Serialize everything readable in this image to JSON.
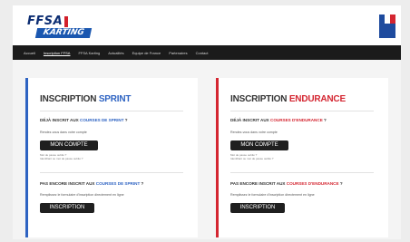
{
  "header": {
    "logo_top": "FFSA",
    "logo_bottom": "KARTING"
  },
  "nav": {
    "items": [
      "Accueil",
      "Inscription FFSA",
      "FFSA Karting",
      "Actualités",
      "Equipe de France",
      "Partenaires",
      "Contact"
    ]
  },
  "sprint": {
    "title_prefix": "INSCRIPTION ",
    "title_highlight": "SPRINT",
    "q1_prefix": "DÉJÀ INSCRIT AUX ",
    "q1_link": "COURSES DE SPRINT",
    "q1_suffix": " ?",
    "q1_help": "Rendez-vous dans votre compte",
    "account_button": "MON COMPTE",
    "tiny_1": "Mot de passe oublié ?",
    "tiny_2": "Identifiant ou mot de passe oublié ?",
    "q2_prefix": "PAS ENCORE INSCRIT AUX ",
    "q2_link": "COURSES DE SPRINT",
    "q2_suffix": " ?",
    "q2_help": "Remplissez le formulaire d'inscription directement en ligne",
    "register_button": "INSCRIPTION"
  },
  "endurance": {
    "title_prefix": "INSCRIPTION ",
    "title_highlight": "ENDURANCE",
    "q1_prefix": "DÉJÀ INSCRIT AUX ",
    "q1_link": "COURSES D'ENDURANCE",
    "q1_suffix": " ?",
    "q1_help": "Rendez-vous dans votre compte",
    "account_button": "MON COMPTE",
    "tiny_1": "Mot de passe oublié ?",
    "tiny_2": "Identifiant ou mot de passe oublié ?",
    "q2_prefix": "PAS ENCORE INSCRIT AUX ",
    "q2_link": "COURSES D'ENDURANCE",
    "q2_suffix": " ?",
    "q2_help": "Remplissez le formulaire d'inscription directement en ligne",
    "register_button": "INSCRIPTION"
  },
  "colors": {
    "sprint_accent": "#2e63c2",
    "endurance_accent": "#d42631",
    "nav_bg": "#1b1b1b",
    "button_bg": "#1f1f1f",
    "logo_blue": "#1a57b0",
    "logo_red": "#d21f2a"
  },
  "icons": {
    "flag": "french-republic-flag-icon"
  }
}
